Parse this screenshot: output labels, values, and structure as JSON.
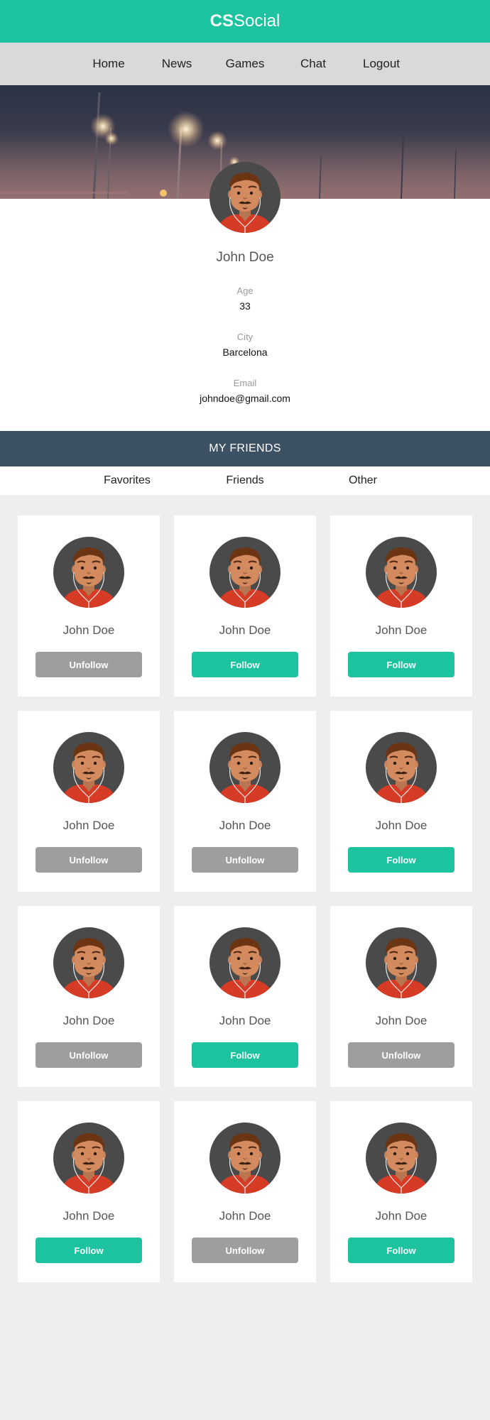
{
  "brand": {
    "bold": "CS",
    "light": "Social"
  },
  "nav": {
    "items": [
      "Home",
      "News",
      "Games",
      "Chat",
      "Logout"
    ]
  },
  "profile": {
    "name": "John Doe",
    "fields": [
      {
        "label": "Age",
        "value": "33"
      },
      {
        "label": "City",
        "value": "Barcelona"
      },
      {
        "label": "Email",
        "value": "johndoe@gmail.com"
      }
    ]
  },
  "friends": {
    "header": "MY FRIENDS",
    "tabs": [
      "Favorites",
      "Friends",
      "Other"
    ],
    "cards": [
      {
        "name": "John Doe",
        "action": "Unfollow"
      },
      {
        "name": "John Doe",
        "action": "Follow"
      },
      {
        "name": "John Doe",
        "action": "Follow"
      },
      {
        "name": "John Doe",
        "action": "Unfollow"
      },
      {
        "name": "John Doe",
        "action": "Unfollow"
      },
      {
        "name": "John Doe",
        "action": "Follow"
      },
      {
        "name": "John Doe",
        "action": "Unfollow"
      },
      {
        "name": "John Doe",
        "action": "Follow"
      },
      {
        "name": "John Doe",
        "action": "Unfollow"
      },
      {
        "name": "John Doe",
        "action": "Follow"
      },
      {
        "name": "John Doe",
        "action": "Unfollow"
      },
      {
        "name": "John Doe",
        "action": "Follow"
      }
    ]
  },
  "colors": {
    "accent": "#1dc39f",
    "follow": "#1dc39f",
    "unfollow": "#9e9e9e",
    "friends_header": "#3d5164",
    "nav_bg": "#d9d9d9",
    "page_bg": "#eeeeee"
  },
  "icons": {
    "avatar": "user-avatar-icon",
    "cover": "street-lights-cover-image"
  }
}
